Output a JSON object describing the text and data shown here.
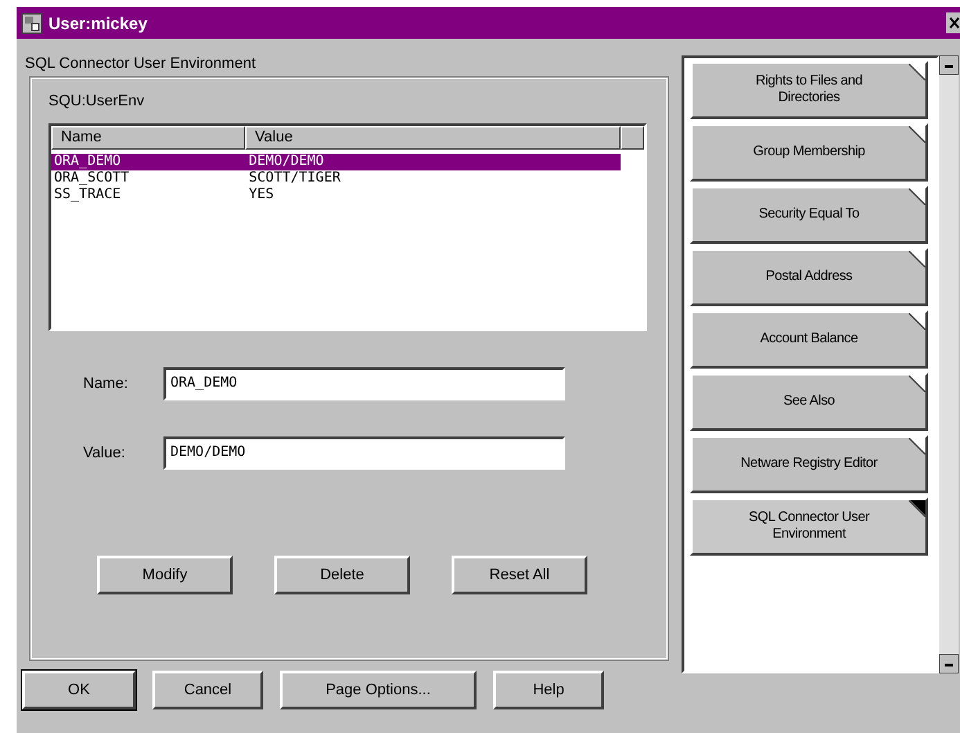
{
  "window": {
    "title": "User:mickey"
  },
  "page_title": "SQL Connector User Environment",
  "group": {
    "label": "SQU:UserEnv",
    "table": {
      "columns": [
        "Name",
        "Value"
      ],
      "rows": [
        {
          "cells": [
            "ORA_DEMO",
            "DEMO/DEMO"
          ],
          "selected": true
        },
        {
          "cells": [
            "ORA_SCOTT",
            "SCOTT/TIGER"
          ],
          "selected": false
        },
        {
          "cells": [
            "SS_TRACE",
            "YES"
          ],
          "selected": false
        }
      ]
    },
    "fields": [
      {
        "label": "Name:",
        "value": "ORA_DEMO"
      },
      {
        "label": "Value:",
        "value": "DEMO/DEMO"
      }
    ],
    "buttons": [
      "Modify",
      "Delete",
      "Reset All"
    ]
  },
  "tabs": [
    {
      "label": "Rights to Files and Directories",
      "selected": false
    },
    {
      "label": "Group Membership",
      "selected": false
    },
    {
      "label": "Security Equal To",
      "selected": false
    },
    {
      "label": "Postal Address",
      "selected": false
    },
    {
      "label": "Account Balance",
      "selected": false
    },
    {
      "label": "See Also",
      "selected": false
    },
    {
      "label": "Netware Registry Editor",
      "selected": false
    },
    {
      "label": "SQL Connector User Environment",
      "selected": true
    }
  ],
  "buttons": [
    "OK",
    "Cancel",
    "Page Options...",
    "Help"
  ]
}
